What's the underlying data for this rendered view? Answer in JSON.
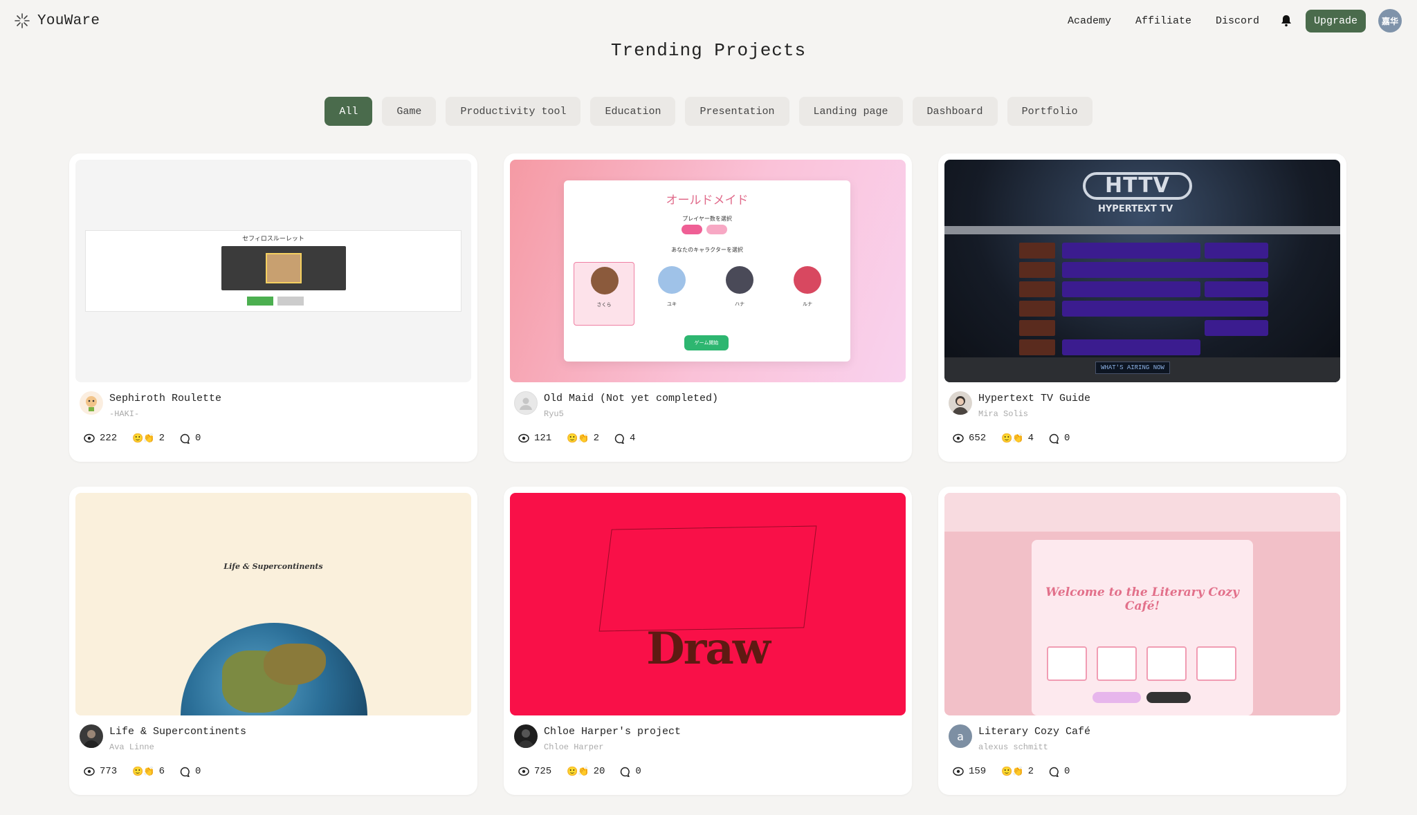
{
  "header": {
    "brand": "YouWare",
    "nav": [
      "Academy",
      "Affiliate",
      "Discord"
    ],
    "upgrade_label": "Upgrade",
    "user_initials": "嘉华"
  },
  "page_title": "Trending Projects",
  "filters": {
    "items": [
      "All",
      "Game",
      "Productivity tool",
      "Education",
      "Presentation",
      "Landing page",
      "Dashboard",
      "Portfolio"
    ],
    "active": "All"
  },
  "accent_color": "#4a6b4c",
  "projects": [
    {
      "name": "Sephiroth Roulette",
      "author": "-HAKI-",
      "views": "222",
      "reactions": "2",
      "comments": "0",
      "thumb": {
        "title": "セフィロスルーレット"
      }
    },
    {
      "name": "Old Maid (Not yet completed)",
      "author": "Ryu5",
      "views": "121",
      "reactions": "2",
      "comments": "4",
      "thumb": {
        "title": "オールドメイド",
        "subtitle1": "プレイヤー数を選択",
        "subtitle2": "あなたのキャラクターを選択",
        "characters": [
          "さくら",
          "ユキ",
          "ハナ",
          "ルナ"
        ],
        "start": "ゲーム開始"
      }
    },
    {
      "name": "Hypertext TV Guide",
      "author": "Mira Solis",
      "views": "652",
      "reactions": "4",
      "comments": "0",
      "thumb": {
        "logo": "HTTV",
        "subtitle": "HYPERTEXT TV",
        "lcd": "WHAT'S AIRING NOW"
      }
    },
    {
      "name": "Life & Supercontinents",
      "author": "Ava Linne",
      "views": "773",
      "reactions": "6",
      "comments": "0",
      "thumb": {
        "title": "Life & Supercontinents"
      }
    },
    {
      "name": "Chloe Harper's project",
      "author": "Chloe Harper",
      "views": "725",
      "reactions": "20",
      "comments": "0",
      "thumb": {
        "title": "Draw"
      }
    },
    {
      "name": "Literary Cozy Café",
      "author": "alexus schmitt",
      "views": "159",
      "reactions": "2",
      "comments": "0",
      "author_initial": "a",
      "thumb": {
        "title": "Welcome to the Literary Cozy Café!"
      }
    }
  ],
  "icons": {
    "logo": "sparkle-logo-icon",
    "bell": "bell-icon",
    "views": "eye-icon",
    "reactions": "emoji-reaction-icon",
    "comments": "comment-bubble-icon"
  }
}
